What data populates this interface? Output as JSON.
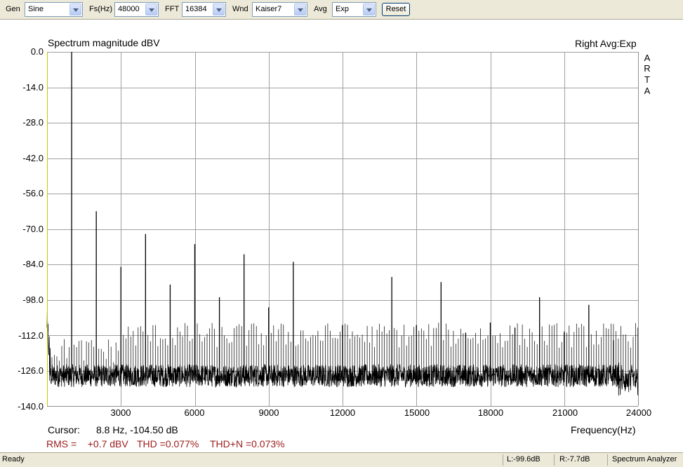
{
  "toolbar": {
    "gen_label": "Gen",
    "gen_value": "Sine",
    "fs_label": "Fs(Hz)",
    "fs_value": "48000",
    "fft_label": "FFT",
    "fft_value": "16384",
    "wnd_label": "Wnd",
    "wnd_value": "Kaiser7",
    "avg_label": "Avg",
    "avg_value": "Exp",
    "reset_label": "Reset"
  },
  "plot": {
    "brand_letters": [
      "A",
      "R",
      "T",
      "A"
    ],
    "cursor_label": "Cursor:",
    "cursor_value": "8.8 Hz, -104.50 dB",
    "rms_text": "RMS =    +0.7 dBV",
    "thd_text": "THD =0.077%",
    "thdn_text": "THD+N =0.073%"
  },
  "chart_data": {
    "type": "line",
    "title": "Spectrum magnitude dBV",
    "subtitle": "Right Avg:Exp",
    "xlabel": "Frequency(Hz)",
    "ylabel": "",
    "xlim": [
      0,
      24000
    ],
    "ylim": [
      -140,
      0
    ],
    "grid": true,
    "yticks": [
      "0.0",
      "-14.0",
      "-28.0",
      "-42.0",
      "-56.0",
      "-70.0",
      "-84.0",
      "-98.0",
      "-112.0",
      "-126.0",
      "-140.0"
    ],
    "xticks": [
      "3000",
      "6000",
      "9000",
      "12000",
      "15000",
      "18000",
      "21000",
      "24000"
    ],
    "series": [
      {
        "noise_floor_db": -128,
        "peaks": [
          {
            "freq": 1000,
            "db": 0
          },
          {
            "freq": 2000,
            "db": -63
          },
          {
            "freq": 3000,
            "db": -85
          },
          {
            "freq": 4000,
            "db": -72
          },
          {
            "freq": 5000,
            "db": -92
          },
          {
            "freq": 6000,
            "db": -76
          },
          {
            "freq": 7000,
            "db": -97
          },
          {
            "freq": 8000,
            "db": -80
          },
          {
            "freq": 9000,
            "db": -101
          },
          {
            "freq": 10000,
            "db": -83
          },
          {
            "freq": 12000,
            "db": -108
          },
          {
            "freq": 14000,
            "db": -89
          },
          {
            "freq": 15000,
            "db": -108
          },
          {
            "freq": 16000,
            "db": -91
          },
          {
            "freq": 17000,
            "db": -111
          },
          {
            "freq": 18000,
            "db": -107
          },
          {
            "freq": 19000,
            "db": -109
          },
          {
            "freq": 20000,
            "db": -97
          },
          {
            "freq": 21000,
            "db": -111
          },
          {
            "freq": 22000,
            "db": -100
          },
          {
            "freq": 23000,
            "db": -114
          },
          {
            "freq": 24000,
            "db": -109
          }
        ]
      }
    ]
  },
  "status": {
    "ready": "Ready",
    "left_level": "L:-99.6dB",
    "right_level": "R:-7.7dB",
    "mode": "Spectrum Analyzer"
  }
}
